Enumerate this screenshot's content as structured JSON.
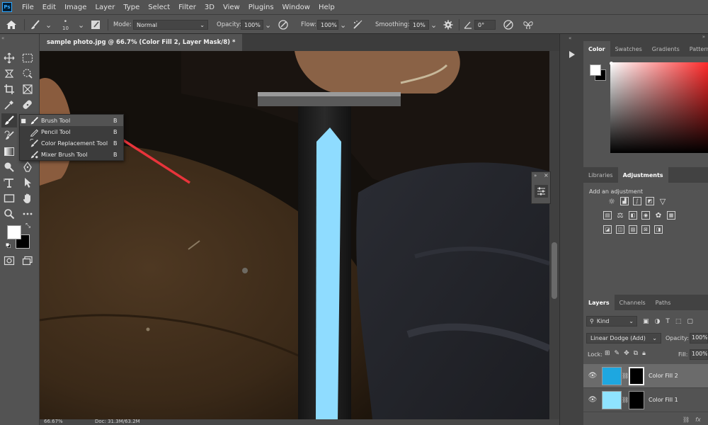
{
  "menu": {
    "items": [
      "File",
      "Edit",
      "Image",
      "Layer",
      "Type",
      "Select",
      "Filter",
      "3D",
      "View",
      "Plugins",
      "Window",
      "Help"
    ]
  },
  "options": {
    "brush_size": "10",
    "mode_label": "Mode:",
    "mode_value": "Normal",
    "opacity_label": "Opacity:",
    "opacity_value": "100%",
    "flow_label": "Flow:",
    "flow_value": "100%",
    "smoothing_label": "Smoothing:",
    "smoothing_value": "10%",
    "angle_value": "0°"
  },
  "document": {
    "tab_title": "sample photo.jpg @ 66.7% (Color Fill 2, Layer Mask/8) *",
    "zoom": "66.67%",
    "doc_size": "Doc: 31.3M/63.2M"
  },
  "flyout": {
    "items": [
      {
        "label": "Brush Tool",
        "key": "B",
        "active": true
      },
      {
        "label": "Pencil Tool",
        "key": "B",
        "active": false
      },
      {
        "label": "Color Replacement Tool",
        "key": "B",
        "active": false
      },
      {
        "label": "Mixer Brush Tool",
        "key": "B",
        "active": false
      }
    ]
  },
  "color_panel": {
    "tabs": [
      "Color",
      "Swatches",
      "Gradients",
      "Patterns"
    ]
  },
  "adjustments_panel": {
    "tabs": [
      "Libraries",
      "Adjustments"
    ],
    "subtitle": "Add an adjustment"
  },
  "layers_panel": {
    "tabs": [
      "Layers",
      "Channels",
      "Paths"
    ],
    "filter_kind": "Kind",
    "blend_mode": "Linear Dodge (Add)",
    "opacity_label": "Opacity:",
    "opacity_value": "100%",
    "lock_label": "Lock:",
    "fill_label": "Fill:",
    "fill_value": "100%",
    "layers": [
      {
        "name": "Color Fill 2",
        "thumb_color": "#1ea7e0",
        "selected": true
      },
      {
        "name": "Color Fill 1",
        "thumb_color": "#8fe3ff",
        "selected": false
      }
    ]
  },
  "colors": {
    "blade": "#8fdcff",
    "arrow": "#e8343b"
  }
}
